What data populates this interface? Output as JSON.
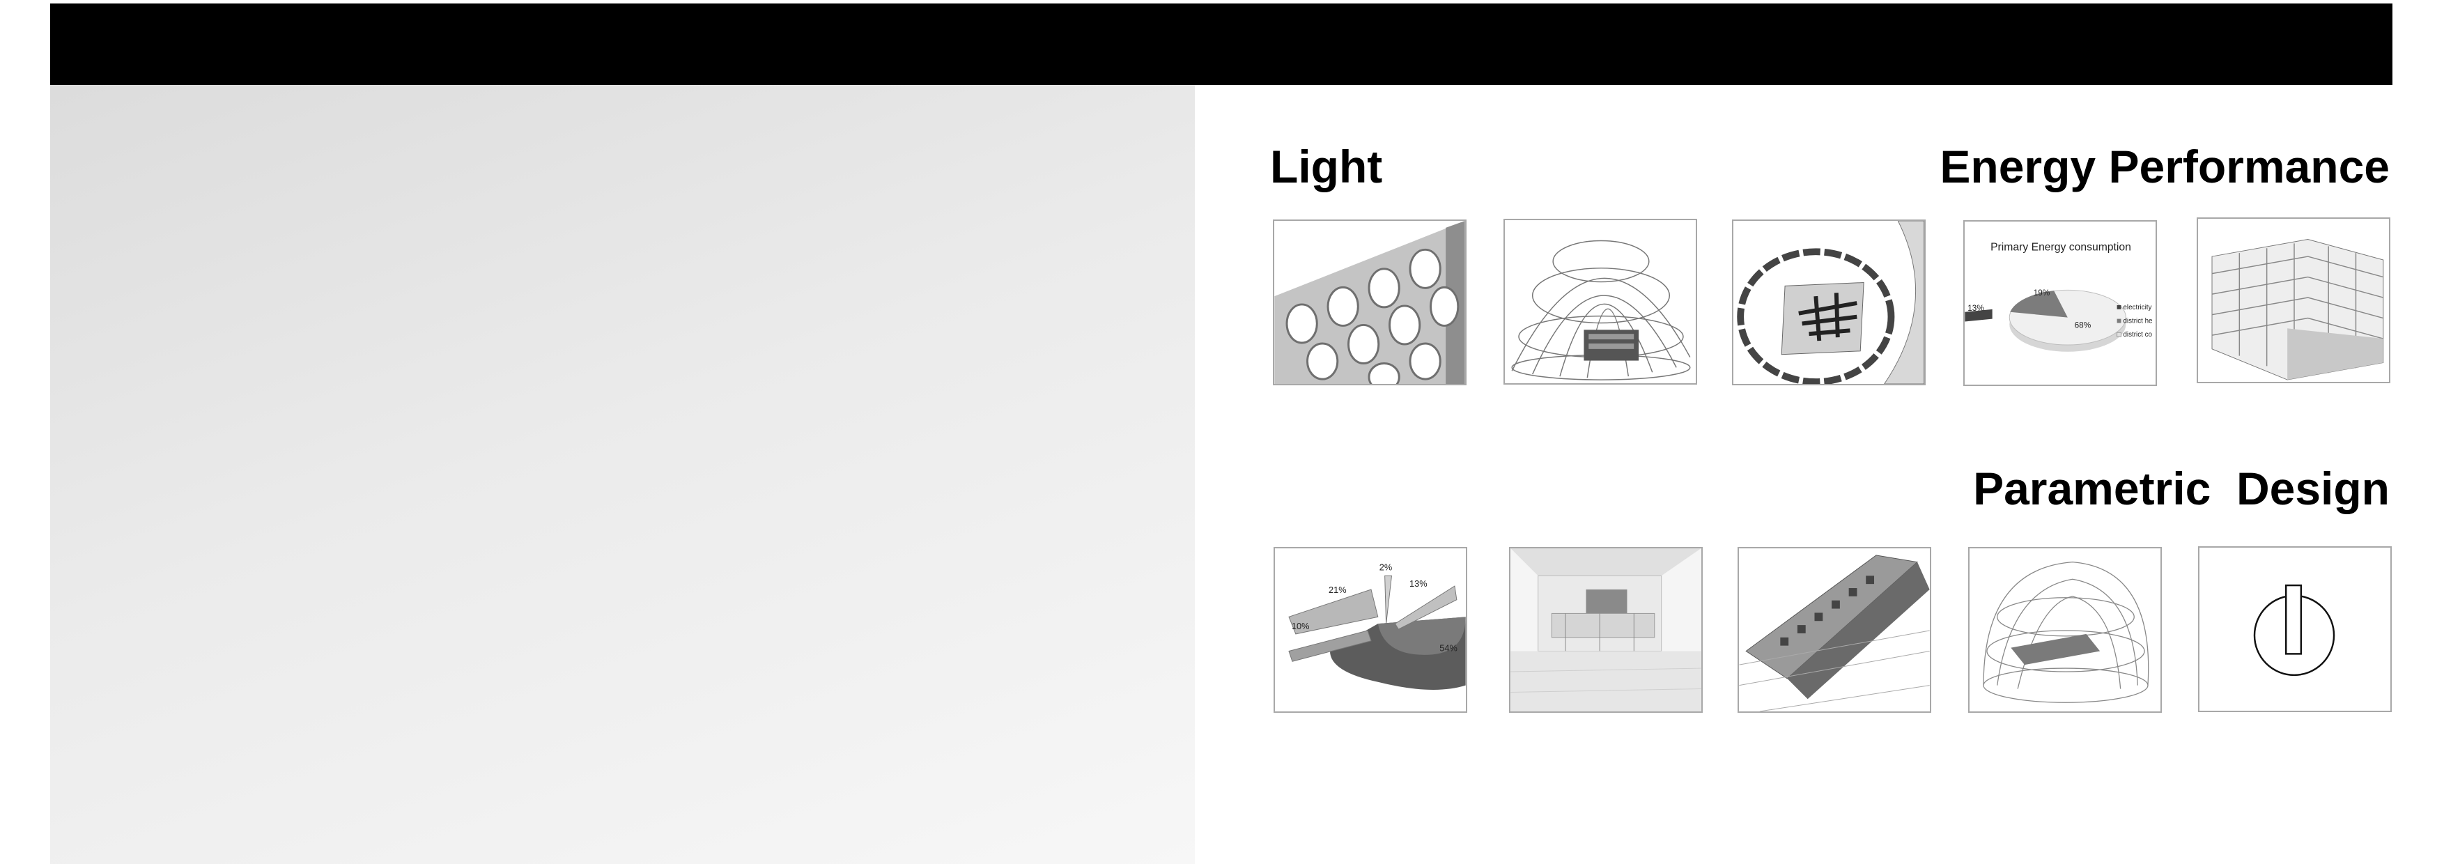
{
  "headings": {
    "light": "Light",
    "energy": "Energy Performance",
    "parametric": "Parametric  Design"
  },
  "energy_chart": {
    "title": "Primary Energy consumption",
    "slices": [
      {
        "label": "19%"
      },
      {
        "label": "13%"
      },
      {
        "label": "68%"
      }
    ],
    "legend": [
      "electricity",
      "district he",
      "district co"
    ]
  },
  "pie_chart_2": {
    "labels": [
      "2%",
      "21%",
      "13%",
      "10%",
      "54%"
    ]
  }
}
